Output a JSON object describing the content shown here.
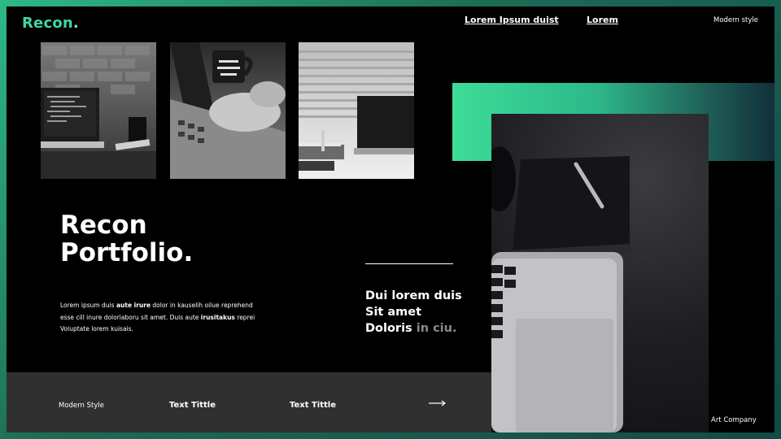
{
  "brand": {
    "logo_text": "Recon",
    "logo_dot": "."
  },
  "nav": {
    "links": [
      {
        "label": "Lorem Ipsum  duist"
      },
      {
        "label": "Lorem"
      }
    ],
    "tagline": "Modern style"
  },
  "hero": {
    "title_line1": "Recon",
    "title_line2": "Portfolio.",
    "body": [
      {
        "parts": [
          {
            "t": "Lorem  ipsum duis ",
            "b": false
          },
          {
            "t": "aute irure",
            "b": true
          },
          {
            "t": " dolor in kauselih oilue reprehend",
            "b": false
          }
        ]
      },
      {
        "parts": [
          {
            "t": "esse cill inure doloriaboru sit amet. Duis aute ",
            "b": false
          },
          {
            "t": "irusitakus",
            "b": true
          },
          {
            "t": " reprei",
            "b": false
          }
        ]
      },
      {
        "parts": [
          {
            "t": "Voluptate lorem kuisais.",
            "b": false
          }
        ]
      }
    ]
  },
  "tagline_block": {
    "line1": "Dui lorem duis",
    "line2": "Sit amet",
    "line3_main": "Doloris ",
    "line3_muted": "in ciu."
  },
  "bottom_bar": {
    "item1": "Modern Style",
    "item2": "Text Tittle",
    "item3": "Text Tittle",
    "arrow_icon": "arrow-right-icon"
  },
  "footer": {
    "company": "Art Company"
  },
  "colors": {
    "accent": "#3dd8a0",
    "background": "#000000",
    "bar": "#303030"
  }
}
